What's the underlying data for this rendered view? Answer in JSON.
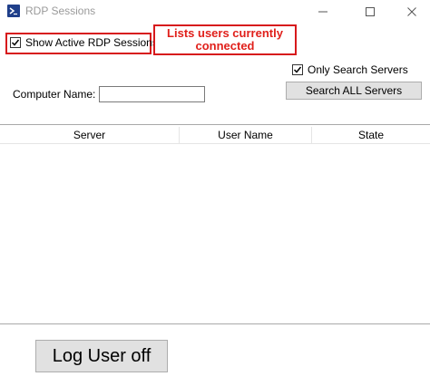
{
  "window": {
    "title": "RDP Sessions",
    "icon": "powershell-icon",
    "controls": {
      "minimize": "—",
      "maximize": "☐",
      "close": "✕"
    }
  },
  "options": {
    "show_active_label": "Show Active RDP Sessions",
    "show_active_checked": true,
    "only_search_label": "Only Search Servers",
    "only_search_checked": true
  },
  "annotation": {
    "line1": "Lists users currently",
    "line2": "connected",
    "color": "#e0201b"
  },
  "search": {
    "computer_name_label": "Computer Name:",
    "computer_name_value": "",
    "search_all_label": "Search ALL Servers"
  },
  "table": {
    "columns": [
      "Server",
      "User Name",
      "State"
    ],
    "rows": []
  },
  "actions": {
    "log_off_label": "Log User off"
  }
}
